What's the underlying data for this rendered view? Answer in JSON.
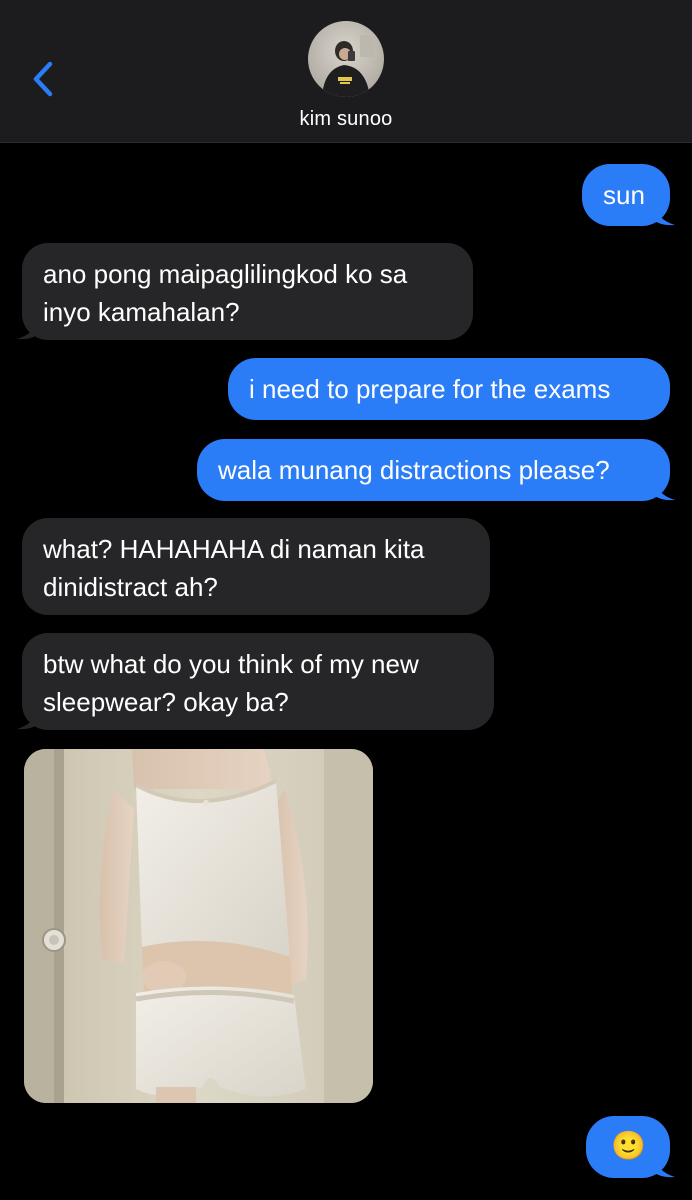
{
  "header": {
    "contact_name": "kim sunoo",
    "back_icon": "chevron-left-icon",
    "accent_color": "#2b7cf7"
  },
  "messages": [
    {
      "direction": "outgoing",
      "text": "sun"
    },
    {
      "direction": "incoming",
      "lines": [
        "ano pong maipaglilingkod ko sa",
        "inyo kamahalan?"
      ]
    },
    {
      "direction": "outgoing",
      "text": "i need to prepare for the exams"
    },
    {
      "direction": "outgoing",
      "text": "wala munang distractions please?"
    },
    {
      "direction": "incoming",
      "lines": [
        "what? HAHAHAHA di naman kita",
        "dinidistract ah?"
      ]
    },
    {
      "direction": "incoming",
      "lines": [
        "btw what do you think of my new",
        "sleepwear? okay ba?"
      ]
    },
    {
      "direction": "incoming",
      "type": "photo",
      "description_icon": "photo-attachment"
    },
    {
      "direction": "outgoing",
      "text": "🙂"
    }
  ],
  "colors": {
    "outgoing_bubble": "#2b7cf7",
    "incoming_bubble": "#262628",
    "header_bg": "#1c1c1e"
  }
}
